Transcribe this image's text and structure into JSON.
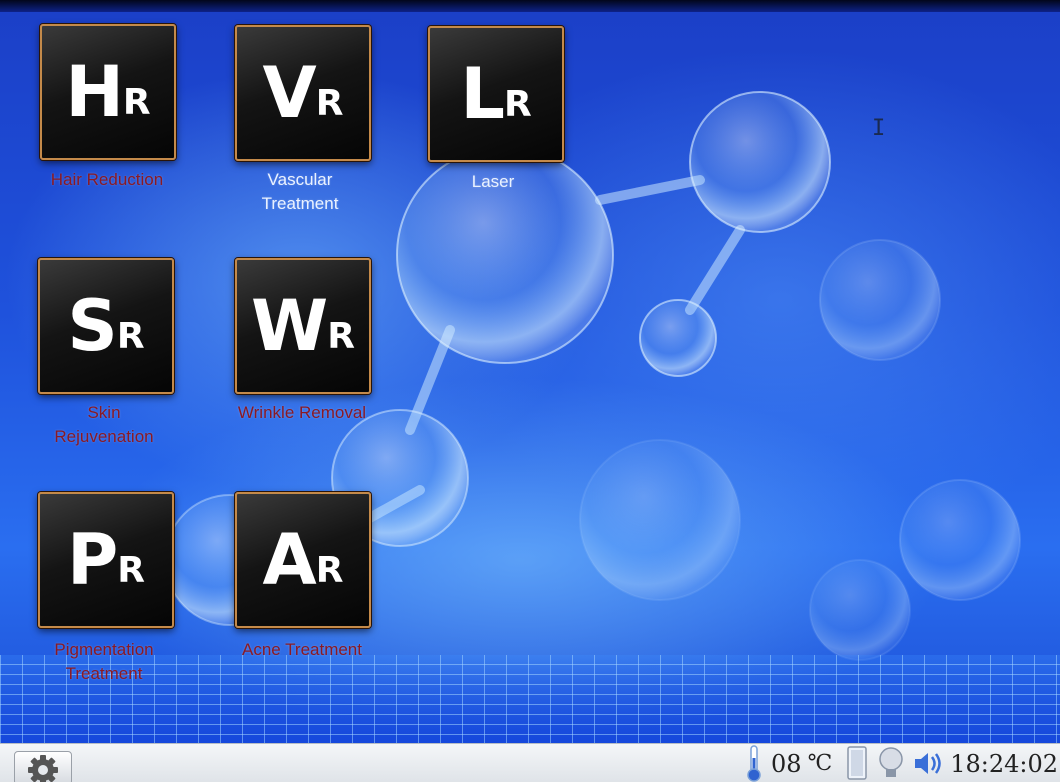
{
  "apps": [
    {
      "id": "hr",
      "big": "H",
      "small": "R",
      "label": "Hair Reduction"
    },
    {
      "id": "vr",
      "big": "V",
      "small": "R",
      "label": "Vascular Treatment"
    },
    {
      "id": "lr",
      "big": "L",
      "small": "R",
      "label": "Laser"
    },
    {
      "id": "sr",
      "big": "S",
      "small": "R",
      "label": "Skin Rejuvenation"
    },
    {
      "id": "wr",
      "big": "W",
      "small": "R",
      "label": "Wrinkle Removal"
    },
    {
      "id": "pr",
      "big": "P",
      "small": "R",
      "label": "Pigmentation Treatment"
    },
    {
      "id": "ar",
      "big": "A",
      "small": "R",
      "label": "Acne Treatment"
    }
  ],
  "status_bar": {
    "temperature": "08",
    "temperature_unit": "℃",
    "time": "18:24:02",
    "icons": [
      "settings-gear-icon",
      "thermometer-icon",
      "water-tank-icon",
      "lamp-icon",
      "speaker-icon"
    ]
  },
  "colors": {
    "label_dark_red": "#8a1a24",
    "label_white": "#eaf2ff",
    "tile_border": "#c48a4a",
    "background_blue": "#1f52dc"
  }
}
